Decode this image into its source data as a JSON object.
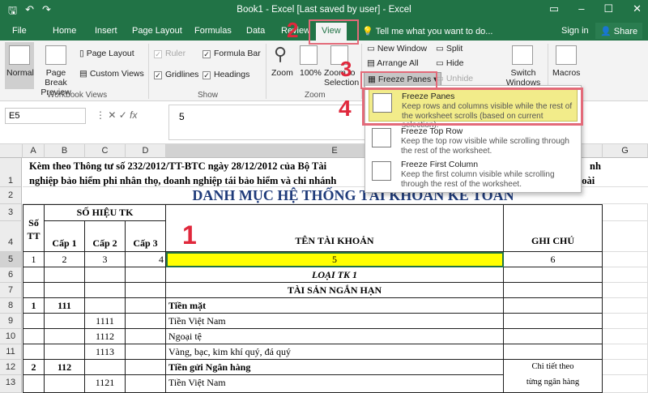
{
  "window": {
    "title": "Book1 - Excel [Last saved by user] - Excel"
  },
  "tabs": [
    "File",
    "Home",
    "Insert",
    "Page Layout",
    "Formulas",
    "Data",
    "Review",
    "View"
  ],
  "tell_me": "Tell me what you want to do...",
  "sign_in": "Sign in",
  "share": "Share",
  "ribbon": {
    "workbook_views": {
      "label": "Workbook Views",
      "normal": "Normal",
      "page_break": "Page Break Preview",
      "page_layout": "Page Layout",
      "custom_views": "Custom Views"
    },
    "show": {
      "label": "Show",
      "ruler": "Ruler",
      "formula_bar": "Formula Bar",
      "gridlines": "Gridlines",
      "headings": "Headings"
    },
    "zoom": {
      "label": "Zoom",
      "zoom": "Zoom",
      "hundred": "100%",
      "zoom_to_selection": "Zoom to Selection"
    },
    "window": {
      "new_window": "New Window",
      "arrange_all": "Arrange All",
      "freeze_panes": "Freeze Panes",
      "split": "Split",
      "hide": "Hide",
      "unhide": "Unhide",
      "switch_windows": "Switch Windows"
    },
    "macros": {
      "macros": "Macros"
    }
  },
  "formula_bar": {
    "name_box": "E5",
    "value": "5"
  },
  "dropdown": {
    "items": [
      {
        "title": "Freeze Panes",
        "desc": "Keep rows and columns visible while the rest of the worksheet scrolls (based on current selection)."
      },
      {
        "title": "Freeze Top Row",
        "desc": "Keep the top row visible while scrolling through the rest of the worksheet."
      },
      {
        "title": "Freeze First Column",
        "desc": "Keep the first column visible while scrolling through the rest of the worksheet."
      }
    ]
  },
  "columns": [
    "A",
    "B",
    "C",
    "D",
    "E",
    "F",
    "G"
  ],
  "rows": [
    "1",
    "2",
    "3",
    "4",
    "5",
    "6",
    "7",
    "8",
    "9",
    "10",
    "11",
    "12",
    "13"
  ],
  "sheet": {
    "row1_line1": "Kèm theo Thông tư số 232/2012/TT-BTC ngày 28/12/2012 của Bộ Tài",
    "row1_line1_tail": "nh",
    "row1_line2": "nghiệp bảo hiểm phi nhân thọ, doanh nghiệp tái bảo hiểm và chi nhánh",
    "row1_line2_tail": "ngoài",
    "title": "DANH MỤC HỆ THỐNG TÀI KHOẢN KẾ TOÁN",
    "so_tt": "Số TT",
    "so_hieu_tk": "SỐ HIỆU TK",
    "cap1": "Cấp 1",
    "cap2": "Cấp 2",
    "cap3": "Cấp 3",
    "ten_tai_khoan": "TÊN TÀI KHOẢN",
    "ghi_chu": "GHI CHÚ",
    "row5": [
      "1",
      "2",
      "3",
      "4",
      "5",
      "6"
    ],
    "loai": "LOẠI TK 1",
    "tai_san": "TÀI SẢN NGẮN HẠN",
    "r8": {
      "stt": "1",
      "cap1": "111",
      "name": "Tiền mặt"
    },
    "r9": {
      "cap2": "1111",
      "name": "Tiền Việt Nam"
    },
    "r10": {
      "cap2": "1112",
      "name": "Ngoại tệ"
    },
    "r11": {
      "cap2": "1113",
      "name": "Vàng, bạc, kim khí quý, đá quý"
    },
    "r12": {
      "stt": "2",
      "cap1": "112",
      "name": "Tiền gửi Ngân hàng",
      "note": "Chi tiết theo"
    },
    "r13": {
      "cap2": "1121",
      "name": "Tiền Việt Nam",
      "note": "từng ngân hàng"
    }
  },
  "annotations": [
    "1",
    "2",
    "3",
    "4"
  ],
  "colors": {
    "excel_green": "#217346",
    "highlight_yellow": "#ffff00",
    "annotation_red": "#e0283c"
  }
}
